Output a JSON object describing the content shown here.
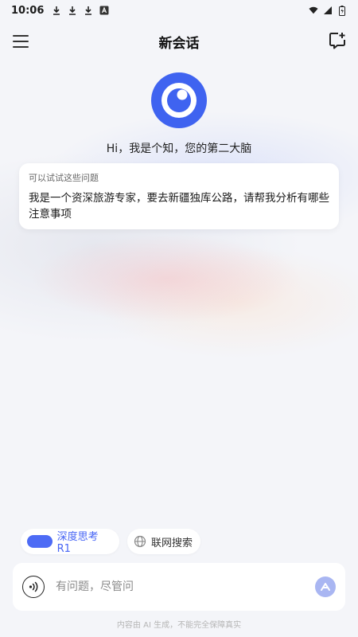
{
  "status_bar": {
    "time": "10:06"
  },
  "header": {
    "title": "新会话"
  },
  "assistant": {
    "greeting": "Hi，我是个知，您的第二大脑"
  },
  "suggestions": {
    "title": "可以试试这些问题",
    "items": [
      {
        "text": "我是一个资深旅游专家，要去新疆独库公路，请帮我分析有哪些注意事项"
      }
    ]
  },
  "modes": {
    "deep_think_label": "深度思考R1",
    "web_search_label": "联网搜索"
  },
  "composer": {
    "placeholder": "有问题，尽管问",
    "value": ""
  },
  "footer": {
    "disclaimer": "内容由 AI 生成，不能完全保障真实"
  },
  "colors": {
    "accent": "#4d6bf5",
    "send_disabled": "#a9b6f2",
    "background": "#f4f5f9"
  },
  "icons": [
    "download-icon",
    "download-icon",
    "download-icon",
    "text-icon",
    "wifi-icon",
    "signal-icon",
    "battery-icon",
    "menu-icon",
    "new-chat-icon",
    "app-logo",
    "globe-icon",
    "voice-icon",
    "send-icon"
  ]
}
